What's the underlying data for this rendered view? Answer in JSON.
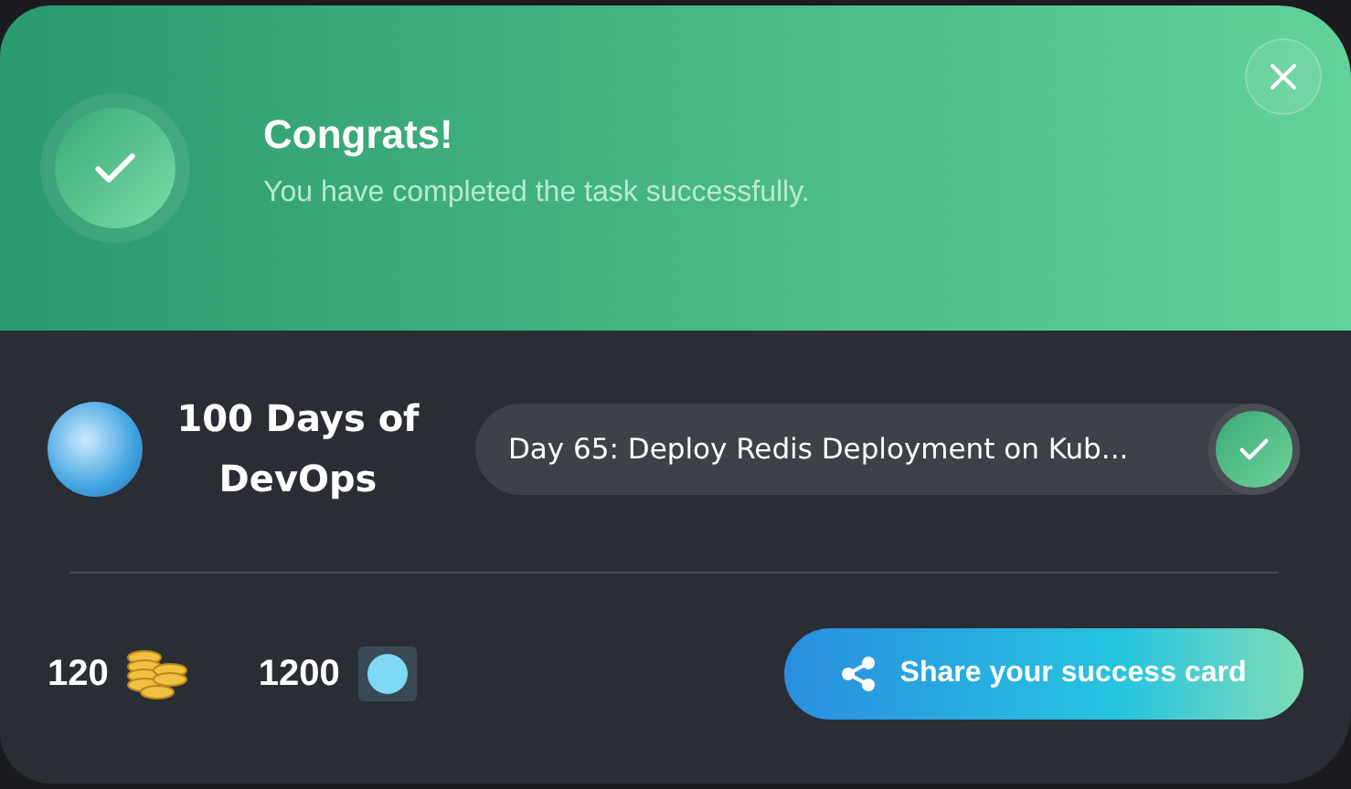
{
  "banner": {
    "title": "Congrats!",
    "message": "You have completed the task successfully."
  },
  "course": {
    "title": "100 Days of DevOps"
  },
  "task": {
    "label": "Day 65: Deploy Redis Deployment on Kub...",
    "completed": true
  },
  "rewards": [
    {
      "kind": "coins",
      "amount": "120"
    },
    {
      "kind": "gem",
      "amount": "1200"
    }
  ],
  "share_button": {
    "label": "Share your success card"
  }
}
